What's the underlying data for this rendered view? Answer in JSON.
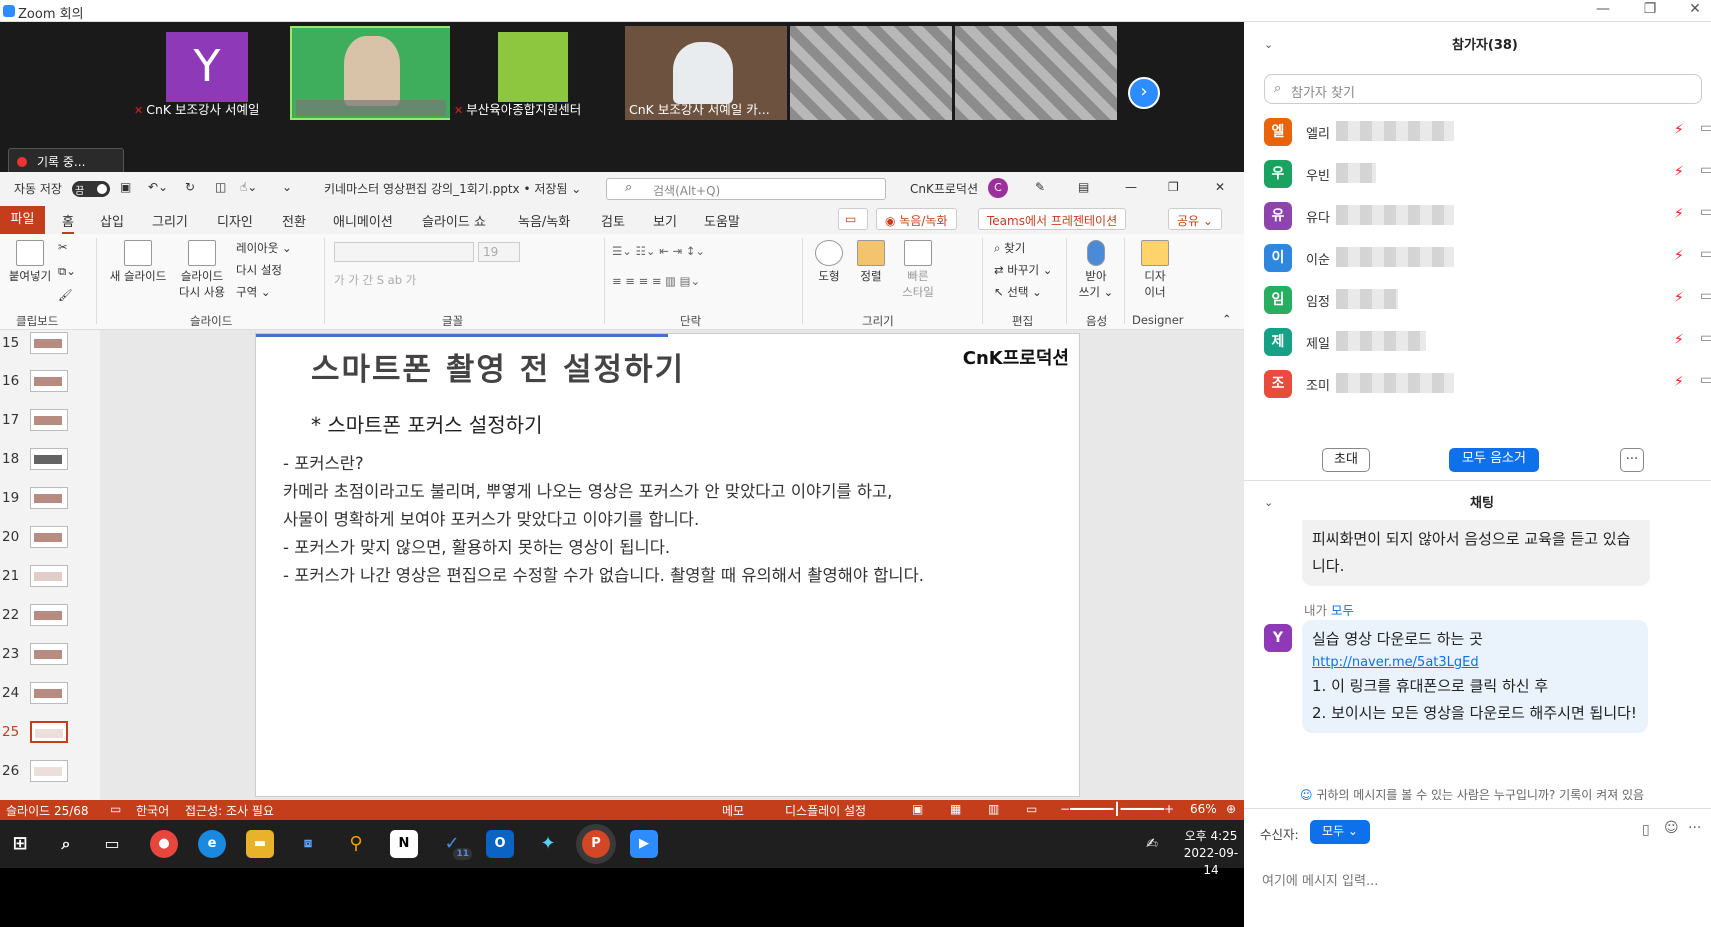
{
  "zoom": {
    "title": "Zoom 회의",
    "win_controls": [
      "—",
      "❐",
      "✕"
    ]
  },
  "video": {
    "tiles": [
      {
        "name": "CnK 보조강사 서예일",
        "muted": true,
        "avatar": "Y"
      },
      {
        "name": "",
        "muted": false
      },
      {
        "name": "부산육아종합지원센터",
        "muted": true
      },
      {
        "name": "CnK 보조강사 서예일 카...",
        "muted": false
      },
      {
        "name": "",
        "muted": false
      },
      {
        "name": "",
        "muted": false
      }
    ],
    "next_icon": "›",
    "recording": "기록 중..."
  },
  "ppt": {
    "autosave_label": "자동 저장",
    "autosave_state": "끔",
    "doc_title": "키네마스터 영상편집 강의_1회기.pptx • 저장됨 ⌄",
    "search_placeholder": "검색(Alt+Q)",
    "account": "CnK프로덕션",
    "account_initial": "C",
    "win_controls": [
      "—",
      "❐",
      "✕"
    ],
    "tabs": [
      "파일",
      "홈",
      "삽입",
      "그리기",
      "디자인",
      "전환",
      "애니메이션",
      "슬라이드 쇼",
      "녹음/녹화",
      "검토",
      "보기",
      "도움말"
    ],
    "tab_record": "◉ 녹음/녹화",
    "tab_teams": "Teams에서 프레젠테이션",
    "tab_share": "공유 ⌄",
    "ribbon": {
      "paste": "붙여넣기",
      "clipboard": "클립보드",
      "new_slide": "새 슬라이드",
      "reuse_slide": "슬라이드\n다시 사용",
      "layout": "레이아웃 ⌄",
      "reset": "다시 설정",
      "section": "구역 ⌄",
      "slides_group": "슬라이드",
      "font_size": "19",
      "font_group": "글꼴",
      "para_group": "단락",
      "shapes": "도형",
      "arrange": "정렬",
      "quick_styles": "빠른\n스타일",
      "drawing_group": "그리기",
      "find": "찾기",
      "replace": "바꾸기 ⌄",
      "select": "선택 ⌄",
      "edit_group": "편집",
      "dictate": "받아\n쓰기 ⌄",
      "voice_group": "음성",
      "designer": "디자\n이너",
      "designer_group": "Designer"
    },
    "thumbnails": [
      "15",
      "16",
      "17",
      "18",
      "19",
      "20",
      "21",
      "22",
      "23",
      "24",
      "25",
      "26"
    ],
    "selected_slide": "25",
    "slide": {
      "title": "스마트폰 촬영 전 설정하기",
      "brand": "CnK프로덕션",
      "subtitle": "* 스마트폰 포커스 설정하기",
      "lines": [
        "-   포커스란?",
        "카메라 초점이라고도 불리며, 뿌옇게 나오는 영상은 포커스가 안 맞았다고 이야기를 하고,",
        "사물이 명확하게 보여야 포커스가 맞았다고 이야기를 합니다.",
        "-   포커스가 맞지 않으면, 활용하지 못하는 영상이 됩니다.",
        "-  포커스가 나간 영상은 편집으로 수정할 수가 없습니다. 촬영할 때 유의해서 촬영해야 합니다."
      ]
    },
    "status": {
      "slide": "슬라이드 25/68",
      "lang": "한국어",
      "access": "접근성: 조사 필요",
      "notes": "메모",
      "display": "디스플레이 설정",
      "zoom": "66%"
    }
  },
  "taskbar": {
    "time": "오후 4:25",
    "date": "2022-09-14",
    "outlook_badge": "11"
  },
  "panel": {
    "participants_title": "참가자(38)",
    "search_placeholder": "참가자 찾기",
    "participants": [
      {
        "initial": "엘",
        "color": "#e8630a",
        "name": "엘리"
      },
      {
        "initial": "우",
        "color": "#1aa260",
        "name": "우빈"
      },
      {
        "initial": "유",
        "color": "#8e44ad",
        "name": "유다"
      },
      {
        "initial": "이",
        "color": "#2e86de",
        "name": "이순"
      },
      {
        "initial": "임",
        "color": "#27ae60",
        "name": "임정"
      },
      {
        "initial": "제",
        "color": "#16a085",
        "name": "제일"
      },
      {
        "initial": "조",
        "color": "#e74c3c",
        "name": "조미"
      }
    ],
    "invite": "초대",
    "mute_all": "모두 음소거",
    "more": "···",
    "chat_title": "채팅",
    "msg1": "피씨화면이 되지 않아서 음성으로 교육을 듣고 있습니다.",
    "sender_prefix": "내가",
    "sender_target": "모두",
    "my_initial": "Y",
    "msg2_line1": "실습 영상 다운로드 하는 곳",
    "msg2_link": "http://naver.me/5at3LgEd",
    "msg2_line2": "1. 이 링크를 휴대폰으로 클릭 하신 후",
    "msg2_line3": "2. 보이시는 모든 영상을 다운로드 해주시면 됩니다!",
    "visibility_note": "귀하의 메시지를 볼 수 있는 사람은 누구입니까? 기록이 켜져 있음",
    "to_label": "수신자:",
    "to_value": "모두 ⌄",
    "input_placeholder": "여기에 메시지 입력..."
  }
}
